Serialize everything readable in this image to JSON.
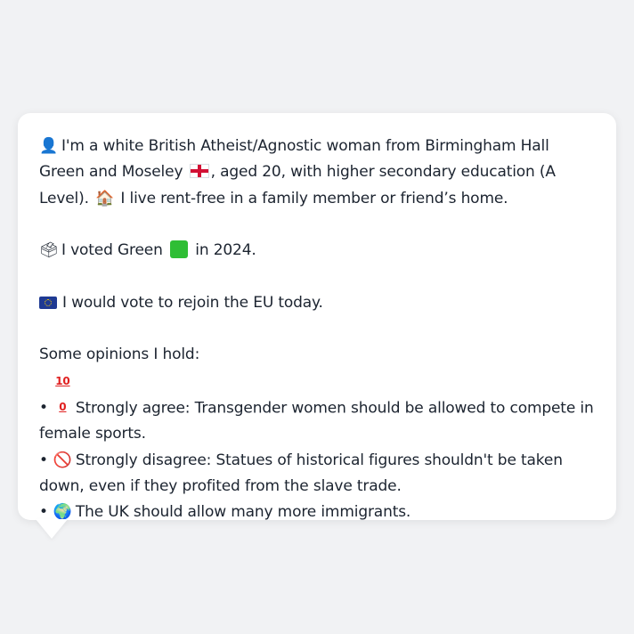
{
  "message": {
    "intro": {
      "icon": "bust-in-silhouette-icon",
      "icon_glyph": "👤",
      "text_before_flag": "I'm a white British Atheist/Agnostic woman from Birmingham Hall Green and Moseley",
      "flag_icon": "england-flag-icon",
      "text_after_flag": ", aged 20, with higher secondary education (A Level).",
      "house_icon": "house-icon",
      "house_glyph": "🏠",
      "text_after_house": "I live rent-free in a family member or friend’s home."
    },
    "vote": {
      "icon": "ballot-box-icon",
      "icon_glyph": "🗳",
      "text_before": "I voted Green",
      "square_icon": "green-square-icon",
      "text_after": "in 2024."
    },
    "eu": {
      "icon": "eu-flag-icon",
      "text": "I would vote to rejoin the EU today."
    },
    "opinions": {
      "heading": "Some opinions I hold:",
      "bullet": "•",
      "items": [
        {
          "icon": "hundred-points-icon",
          "icon_glyph": "100",
          "text": "Strongly agree: Transgender women should be allowed to compete in female sports."
        },
        {
          "icon": "prohibited-icon",
          "icon_glyph": "🚫",
          "text": "Strongly disagree: Statues of historical figures shouldn't be taken down, even if they profited from the slave trade."
        },
        {
          "icon": "globe-icon",
          "icon_glyph": "🌍",
          "text": "The UK should allow many more immigrants."
        }
      ]
    }
  },
  "colors": {
    "background": "#f1f2f4",
    "bubble": "#ffffff",
    "text": "#1c2430",
    "green_square": "#2fbe35",
    "eu_blue": "#1f3a93",
    "england_red": "#d21034"
  }
}
